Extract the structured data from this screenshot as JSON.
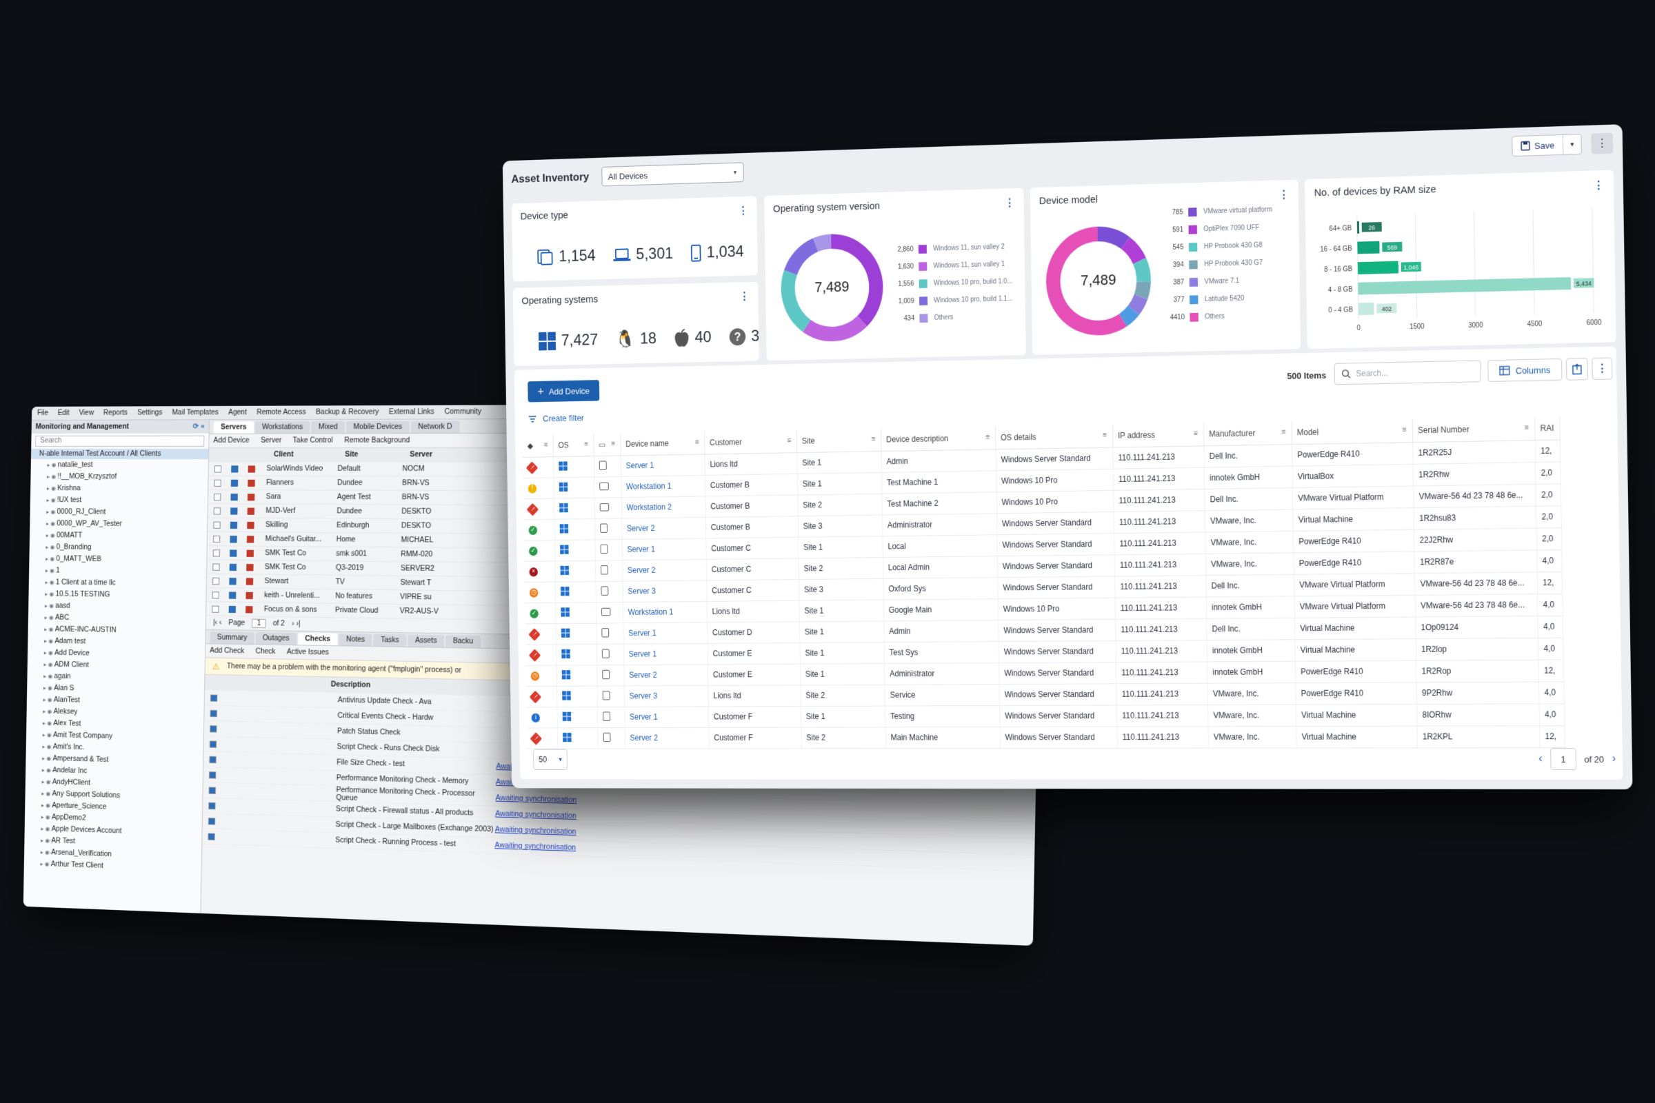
{
  "legacy": {
    "menu": [
      "File",
      "Edit",
      "View",
      "Reports",
      "Settings",
      "Mail Templates",
      "Agent",
      "Remote Access",
      "Backup & Recovery",
      "External Links",
      "Community"
    ],
    "panel_title": "Monitoring and Management",
    "search_placeholder": "Search",
    "selected_node": "N-able Internal Test Account / All Clients",
    "tree": [
      "natalie_test",
      "!!__MOB_Krzysztof",
      "Krishna",
      "!UX test",
      "0000_RJ_Client",
      "0000_WP_AV_Tester",
      "00MATT",
      "0_Branding",
      "0_MATT_WEB",
      "1",
      "1 Client at a time llc",
      "10.5.15 TESTING",
      "aasd",
      "ABC",
      "ACME-INC-AUSTIN",
      "Adam test",
      "Add Device",
      "ADM Client",
      "again",
      "Alan S",
      "AlanTest",
      "Aleksey",
      "Alex Test",
      "Amit Test Company",
      "Amit's Inc.",
      "Ampersand & Test",
      "Andelar Inc",
      "AndyHClient",
      "Any Support Solutions",
      "Aperture_Science",
      "AppDemo2",
      "Apple Devices Account",
      "AR Test",
      "Arsenal_Verification",
      "Arthur Test Client"
    ],
    "top_tabs": [
      "Servers",
      "Workstations",
      "Mixed",
      "Mobile Devices",
      "Network D"
    ],
    "top_tools": [
      "Add Device",
      "Server",
      "Take Control",
      "Remote Background"
    ],
    "grid_header": [
      "Client",
      "Site",
      "Server"
    ],
    "grid_rows": [
      {
        "name": "SolarWinds Video",
        "site": "Default",
        "server": "NOCM"
      },
      {
        "name": "Flanners",
        "site": "Dundee",
        "server": "BRN-VS"
      },
      {
        "name": "Sara",
        "site": "Agent Test",
        "server": "BRN-VS"
      },
      {
        "name": "MJD-Verf",
        "site": "Dundee",
        "server": "DESKTO"
      },
      {
        "name": "Skilling",
        "site": "Edinburgh",
        "server": "DESKTO"
      },
      {
        "name": "Michael's Guitar...",
        "site": "Home",
        "server": "MICHAEL"
      },
      {
        "name": "SMK Test Co",
        "site": "smk s001",
        "server": "RMM-020"
      },
      {
        "name": "SMK Test Co",
        "site": "Q3-2019",
        "server": "SERVER2"
      },
      {
        "name": "Stewart",
        "site": "TV",
        "server": "Stewart T"
      },
      {
        "name": "keith - Unrelenti...",
        "site": "No features",
        "server": "VIPRE su"
      },
      {
        "name": "Focus on & sons",
        "site": "Private Cloud",
        "server": "VR2-AUS-V"
      }
    ],
    "pager": {
      "page_label": "Page",
      "page": "1",
      "of": "of 2"
    },
    "bottom_tabs": [
      "Summary",
      "Outages",
      "Checks",
      "Notes",
      "Tasks",
      "Assets",
      "Backu"
    ],
    "bottom_tools": [
      "Add Check",
      "Check",
      "Active Issues"
    ],
    "warning": "There may be a problem with the monitoring agent (\"fmplugin\" process) or",
    "checks_header": "Description",
    "checks": [
      {
        "desc": "Antivirus Update Check - Ava",
        "status": ""
      },
      {
        "desc": "Critical Events Check - Hardw",
        "status": ""
      },
      {
        "desc": "Patch Status Check",
        "status": ""
      },
      {
        "desc": "Script Check - Runs Check Disk",
        "status": ""
      },
      {
        "desc": "File Size Check - test",
        "status": "Awaiting synchronisation"
      },
      {
        "desc": "Performance Monitoring Check - Memory",
        "status": "Awaiting synchronisation"
      },
      {
        "desc": "Performance Monitoring Check - Processor Queue",
        "status": "Awaiting synchronisation"
      },
      {
        "desc": "Script Check - Firewall status - All products",
        "status": "Awaiting synchronisation"
      },
      {
        "desc": "Script Check - Large Mailboxes (Exchange 2003)",
        "status": "Awaiting synchronisation"
      },
      {
        "desc": "Script Check - Running Process - test",
        "status": "Awaiting synchronisation"
      }
    ]
  },
  "app": {
    "title": "Asset Inventory",
    "filter_value": "All Devices",
    "save_label": "Save"
  },
  "cards": {
    "device_type": {
      "title": "Device type",
      "servers": "1,154",
      "laptops": "5,301",
      "mobiles": "1,034"
    },
    "os": {
      "title": "Operating systems",
      "windows": "7,427",
      "linux": "18",
      "apple": "40",
      "unknown": "3"
    },
    "os_version": {
      "title": "Operating system version",
      "total": "7,489",
      "items": [
        {
          "num": "2,860",
          "label": "Windows 11, sun valley 2",
          "color": "#9b3fd6"
        },
        {
          "num": "1,630",
          "label": "Windows 11, sun valley 1",
          "color": "#c063e0"
        },
        {
          "num": "1,556",
          "label": "Windows 10 pro, build 1.0...",
          "color": "#5cc7c4"
        },
        {
          "num": "1,009",
          "label": "Windows 10 pro, build 1.1...",
          "color": "#7f6de0"
        },
        {
          "num": "434",
          "label": "Others",
          "color": "#a995e8"
        }
      ]
    },
    "device_model": {
      "title": "Device model",
      "total": "7,489",
      "items": [
        {
          "num": "785",
          "label": "VMware virtual platform",
          "color": "#7a4fd6"
        },
        {
          "num": "591",
          "label": "OptiPlex 7090 UFF",
          "color": "#b03fd6"
        },
        {
          "num": "545",
          "label": "HP Probook 430 G8",
          "color": "#5cc7c4"
        },
        {
          "num": "394",
          "label": "HP Probook 430 G7",
          "color": "#7aa6b8"
        },
        {
          "num": "387",
          "label": "VMware 7.1",
          "color": "#8f7ee0"
        },
        {
          "num": "377",
          "label": "Latitude 5420",
          "color": "#4d9be0"
        },
        {
          "num": "4410",
          "label": "Others",
          "color": "#e64fb8"
        }
      ]
    },
    "ram": {
      "title": "No. of devices by RAM size"
    }
  },
  "chart_data": {
    "type": "bar",
    "orientation": "horizontal",
    "title": "No. of devices by RAM size",
    "categories": [
      "64+ GB",
      "16 - 64 GB",
      "8 - 16 GB",
      "4 - 8 GB",
      "0 - 4 GB"
    ],
    "values": [
      26,
      569,
      1046,
      5434,
      402
    ],
    "colors": [
      "#0f6b4f",
      "#11a37a",
      "#11b37f",
      "#8fd9c6",
      "#c5e8df"
    ],
    "xticks": [
      0,
      1500,
      3000,
      4500,
      6000
    ],
    "xlim": [
      0,
      6000
    ],
    "grid": true
  },
  "table": {
    "add_label": "Add Device",
    "items_count": "500 Items",
    "search_placeholder": "Search...",
    "columns_label": "Columns",
    "filter_label": "Create filter",
    "headers": [
      "OS",
      "Device name",
      "Customer",
      "Site",
      "Device description",
      "OS details",
      "IP address",
      "Manufacturer",
      "Model",
      "Serial Number",
      "RAI"
    ],
    "rows": [
      {
        "status": "red",
        "dev": "srv",
        "name": "Server 1",
        "customer": "Lions ltd",
        "site": "Site 1",
        "desc": "Admin",
        "os": "Windows Server Standard",
        "ip": "110.111.241.213",
        "mfr": "Dell Inc.",
        "model": "PowerEdge R410",
        "serial": "1R2R25J",
        "ram": "12,"
      },
      {
        "status": "yellow",
        "dev": "ws",
        "name": "Workstation 1",
        "customer": "Customer B",
        "site": "Site 1",
        "desc": "Test Machine 1",
        "os": "Windows 10 Pro",
        "ip": "110.111.241.213",
        "mfr": "innotek GmbH",
        "model": "VirtualBox",
        "serial": "1R2Rhw",
        "ram": "2,0"
      },
      {
        "status": "red",
        "dev": "ws",
        "name": "Workstation 2",
        "customer": "Customer B",
        "site": "Site 2",
        "desc": "Test Machine 2",
        "os": "Windows 10 Pro",
        "ip": "110.111.241.213",
        "mfr": "Dell Inc.",
        "model": "VMware Virtual Platform",
        "serial": "VMware-56 4d 23 78 48 6e...",
        "ram": "2,0"
      },
      {
        "status": "green",
        "dev": "srv",
        "name": "Server 2",
        "customer": "Customer B",
        "site": "Site 3",
        "desc": "Administrator",
        "os": "Windows Server Standard",
        "ip": "110.111.241.213",
        "mfr": "VMware, Inc.",
        "model": "Virtual Machine",
        "serial": "1R2hsu83",
        "ram": "2,0"
      },
      {
        "status": "green",
        "dev": "srv",
        "name": "Server 1",
        "customer": "Customer C",
        "site": "Site 1",
        "desc": "Local",
        "os": "Windows Server Standard",
        "ip": "110.111.241.213",
        "mfr": "VMware, Inc.",
        "model": "PowerEdge R410",
        "serial": "22J2Rhw",
        "ram": "2,0"
      },
      {
        "status": "darkred",
        "dev": "srv",
        "name": "Server 2",
        "customer": "Customer C",
        "site": "Site 2",
        "desc": "Local Admin",
        "os": "Windows Server Standard",
        "ip": "110.111.241.213",
        "mfr": "VMware, Inc.",
        "model": "PowerEdge R410",
        "serial": "1R2R87e",
        "ram": "4,0"
      },
      {
        "status": "orange",
        "dev": "srv",
        "name": "Server 3",
        "customer": "Customer C",
        "site": "Site 3",
        "desc": "Oxford Sys",
        "os": "Windows Server Standard",
        "ip": "110.111.241.213",
        "mfr": "Dell Inc.",
        "model": "VMware Virtual Platform",
        "serial": "VMware-56 4d 23 78 48 6e...",
        "ram": "12,"
      },
      {
        "status": "green",
        "dev": "ws",
        "name": "Workstation 1",
        "customer": "Lions ltd",
        "site": "Site 1",
        "desc": "Google Main",
        "os": "Windows 10 Pro",
        "ip": "110.111.241.213",
        "mfr": "innotek GmbH",
        "model": "VMware Virtual Platform",
        "serial": "VMware-56 4d 23 78 48 6e...",
        "ram": "4,0"
      },
      {
        "status": "red",
        "dev": "srv",
        "name": "Server 1",
        "customer": "Customer D",
        "site": "Site 1",
        "desc": "Admin",
        "os": "Windows Server Standard",
        "ip": "110.111.241.213",
        "mfr": "Dell Inc.",
        "model": "Virtual Machine",
        "serial": "1Op09124",
        "ram": "4,0"
      },
      {
        "status": "red",
        "dev": "srv",
        "name": "Server 1",
        "customer": "Customer E",
        "site": "Site 1",
        "desc": "Test Sys",
        "os": "Windows Server Standard",
        "ip": "110.111.241.213",
        "mfr": "innotek GmbH",
        "model": "Virtual Machine",
        "serial": "1R2lop",
        "ram": "4,0"
      },
      {
        "status": "orange",
        "dev": "srv",
        "name": "Server 2",
        "customer": "Customer E",
        "site": "Site 1",
        "desc": "Administrator",
        "os": "Windows Server Standard",
        "ip": "110.111.241.213",
        "mfr": "innotek GmbH",
        "model": "PowerEdge R410",
        "serial": "1R2Rop",
        "ram": "12,"
      },
      {
        "status": "red",
        "dev": "srv",
        "name": "Server 3",
        "customer": "Lions ltd",
        "site": "Site 2",
        "desc": "Service",
        "os": "Windows Server Standard",
        "ip": "110.111.241.213",
        "mfr": "VMware, Inc.",
        "model": "PowerEdge R410",
        "serial": "9P2Rhw",
        "ram": "4,0"
      },
      {
        "status": "blue",
        "dev": "srv",
        "name": "Server 1",
        "customer": "Customer F",
        "site": "Site 1",
        "desc": "Testing",
        "os": "Windows Server Standard",
        "ip": "110.111.241.213",
        "mfr": "VMware, Inc.",
        "model": "Virtual Machine",
        "serial": "8IORhw",
        "ram": "4,0"
      },
      {
        "status": "red",
        "dev": "srv",
        "name": "Server 2",
        "customer": "Customer F",
        "site": "Site 2",
        "desc": "Main Machine",
        "os": "Windows Server Standard",
        "ip": "110.111.241.213",
        "mfr": "VMware, Inc.",
        "model": "Virtual Machine",
        "serial": "1R2KPL",
        "ram": "12,"
      }
    ],
    "page_size": "50",
    "page": "1",
    "page_of": "of 20"
  }
}
